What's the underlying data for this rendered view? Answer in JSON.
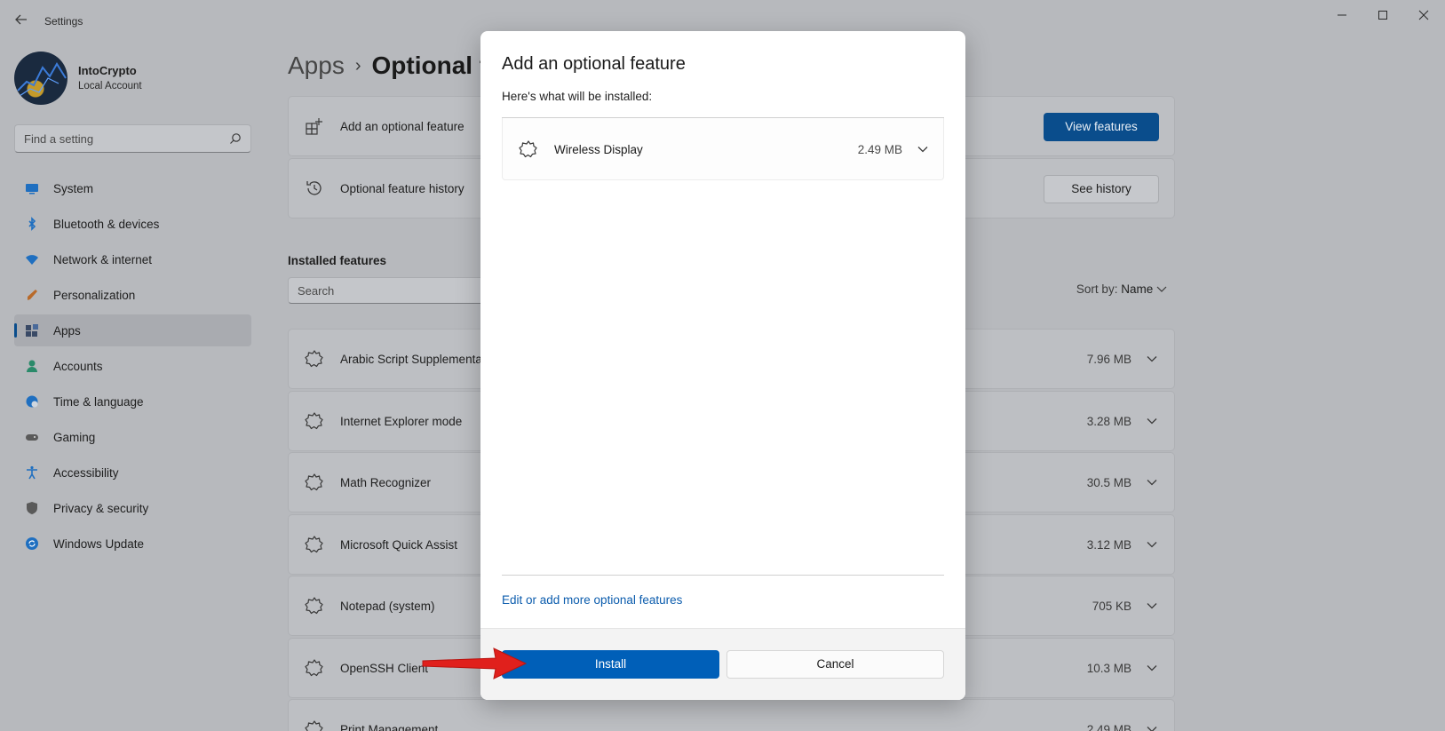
{
  "window": {
    "title": "Settings"
  },
  "user": {
    "name": "IntoCrypto",
    "account_type": "Local Account"
  },
  "sidebar": {
    "search_placeholder": "Find a setting",
    "items": [
      {
        "label": "System",
        "icon": "monitor-icon",
        "color": "#1f6fc0"
      },
      {
        "label": "Bluetooth & devices",
        "icon": "bluetooth-icon",
        "color": "#1f6fc0"
      },
      {
        "label": "Network & internet",
        "icon": "wifi-icon",
        "color": "#1f6fc0"
      },
      {
        "label": "Personalization",
        "icon": "brush-icon",
        "color": "#b86a2a"
      },
      {
        "label": "Apps",
        "icon": "apps-icon",
        "color": "#3a4a66",
        "active": true
      },
      {
        "label": "Accounts",
        "icon": "person-icon",
        "color": "#2a8a6a"
      },
      {
        "label": "Time & language",
        "icon": "globe-clock-icon",
        "color": "#1f6fc0"
      },
      {
        "label": "Gaming",
        "icon": "gamepad-icon",
        "color": "#5a5a5a"
      },
      {
        "label": "Accessibility",
        "icon": "accessibility-icon",
        "color": "#1f6fc0"
      },
      {
        "label": "Privacy & security",
        "icon": "shield-icon",
        "color": "#5a5a5a"
      },
      {
        "label": "Windows Update",
        "icon": "update-icon",
        "color": "#1f6fc0"
      }
    ]
  },
  "content": {
    "breadcrumb_root": "Apps",
    "breadcrumb_separator": "›",
    "breadcrumb_current": "Optional features",
    "add_feature_label": "Add an optional feature",
    "view_features_label": "View features",
    "history_label": "Optional feature history",
    "see_history_label": "See history",
    "installed_title": "Installed features",
    "installed_search_placeholder": "Search",
    "sort_label": "Sort by:",
    "sort_value": "Name",
    "features": [
      {
        "name": "Arabic Script Supplemental Fonts",
        "size": "7.96 MB"
      },
      {
        "name": "Internet Explorer mode",
        "size": "3.28 MB"
      },
      {
        "name": "Math Recognizer",
        "size": "30.5 MB"
      },
      {
        "name": "Microsoft Quick Assist",
        "size": "3.12 MB"
      },
      {
        "name": "Notepad (system)",
        "size": "705 KB"
      },
      {
        "name": "OpenSSH Client",
        "size": "10.3 MB"
      },
      {
        "name": "Print Management",
        "size": "2.49 MB"
      }
    ]
  },
  "dialog": {
    "title": "Add an optional feature",
    "subtitle": "Here's what will be installed:",
    "items": [
      {
        "name": "Wireless Display",
        "size": "2.49 MB"
      }
    ],
    "link": "Edit or add more optional features",
    "install_label": "Install",
    "cancel_label": "Cancel",
    "accent_color": "#005fb8"
  },
  "annotation": {
    "arrow_color": "#e0201c"
  }
}
